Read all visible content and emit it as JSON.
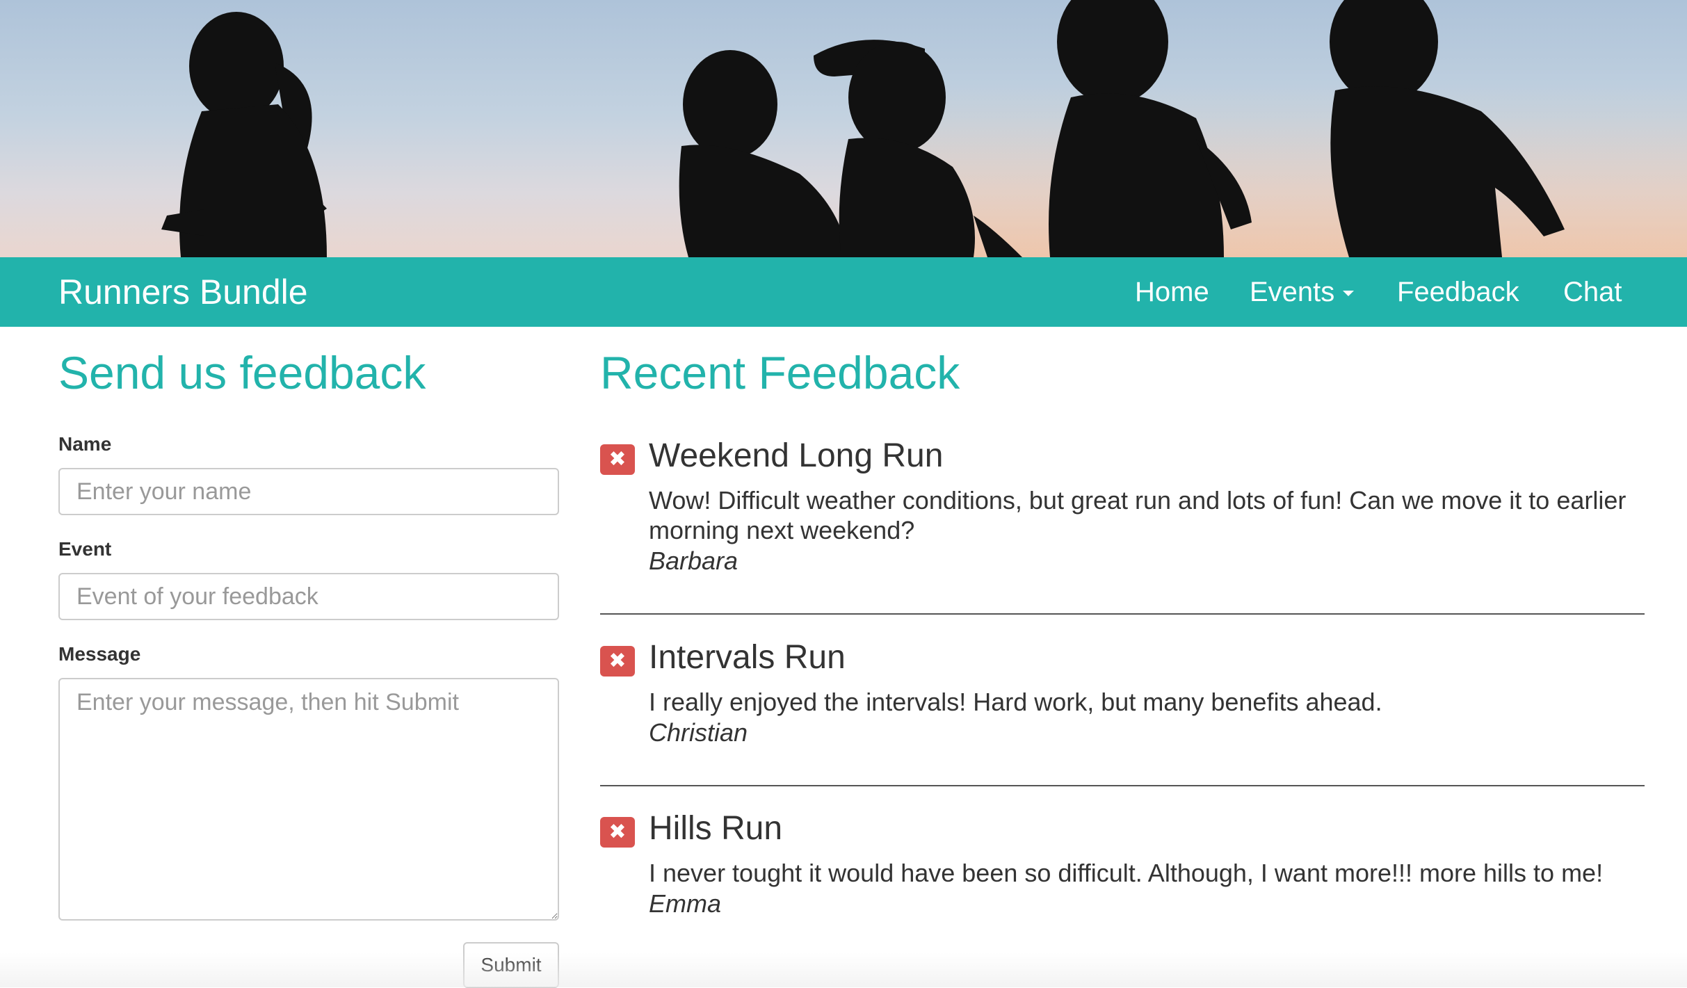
{
  "navbar": {
    "brand": "Runners Bundle",
    "items": [
      {
        "label": "Home"
      },
      {
        "label": "Events"
      },
      {
        "label": "Feedback"
      },
      {
        "label": "Chat"
      }
    ]
  },
  "form": {
    "heading": "Send us feedback",
    "name_label": "Name",
    "name_placeholder": "Enter your name",
    "name_value": "",
    "event_label": "Event",
    "event_placeholder": "Event of your feedback",
    "event_value": "",
    "message_label": "Message",
    "message_placeholder": "Enter your message, then hit Submit",
    "message_value": "",
    "submit_label": "Submit"
  },
  "recent": {
    "heading": "Recent Feedback",
    "items": [
      {
        "title": "Weekend Long Run",
        "message": "Wow! Difficult weather conditions, but great run and lots of fun! Can we move it to earlier morning next weekend?",
        "author": "Barbara"
      },
      {
        "title": "Intervals Run",
        "message": "I really enjoyed the intervals! Hard work, but many benefits ahead.",
        "author": "Christian"
      },
      {
        "title": "Hills Run",
        "message": "I never tought it would have been so difficult. Although, I want more!!! more hills to me!",
        "author": "Emma"
      }
    ]
  },
  "icons": {
    "delete": "close-icon",
    "events_dropdown": "caret-down-icon"
  },
  "colors": {
    "accent": "#22b3ab",
    "danger": "#d9534f"
  }
}
